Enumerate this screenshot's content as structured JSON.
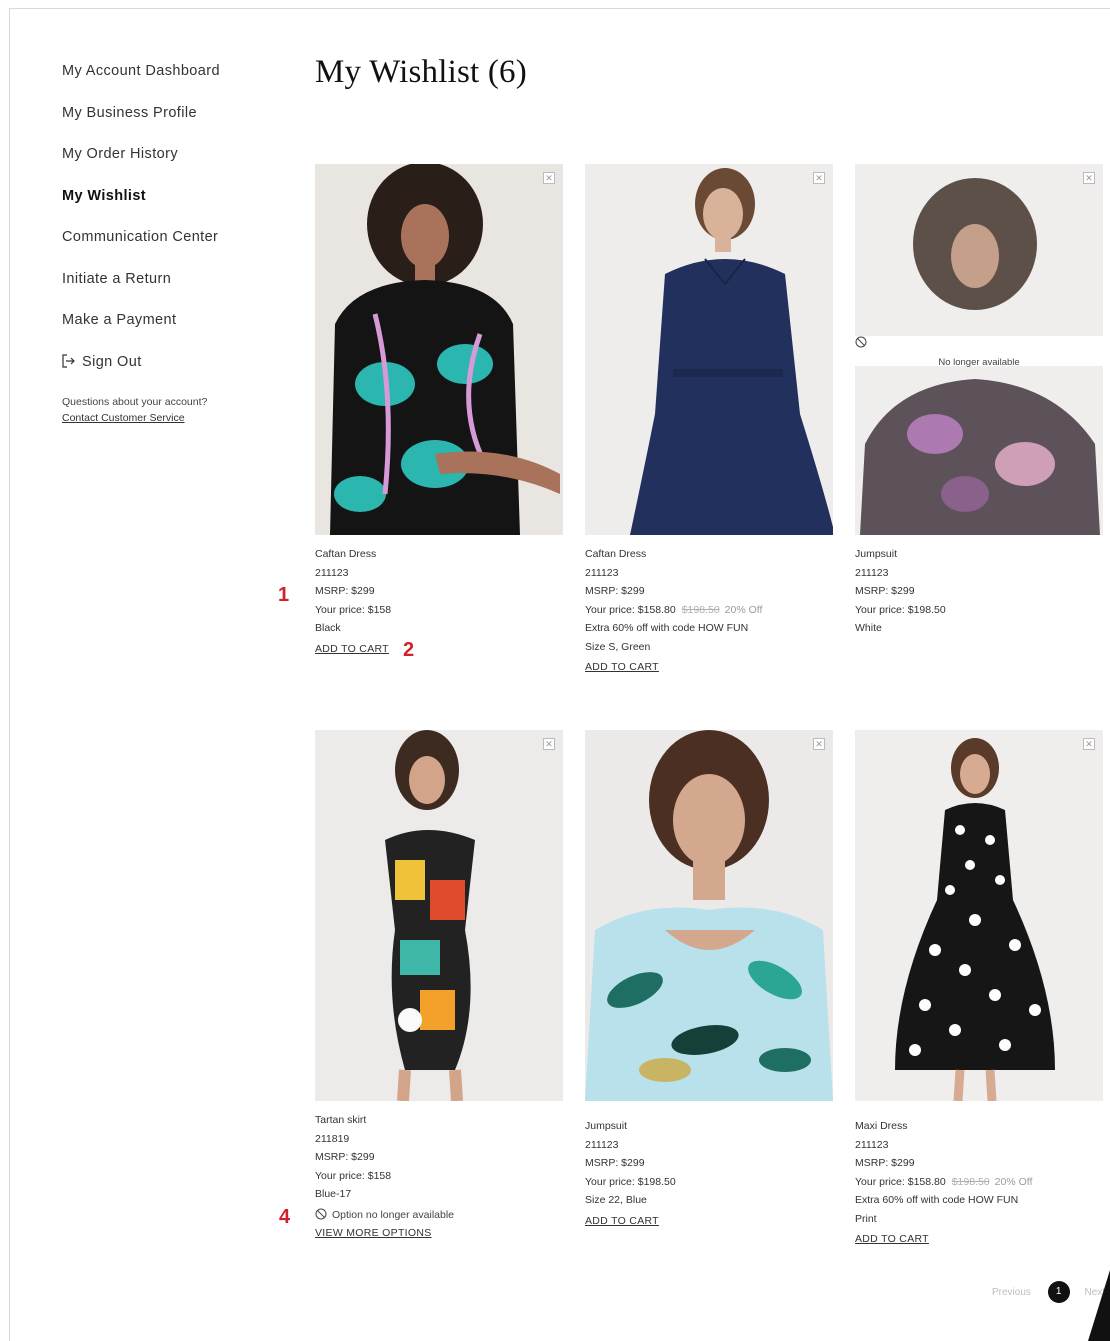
{
  "sidebar": {
    "items": [
      {
        "label": "My Account Dashboard",
        "active": false
      },
      {
        "label": "My Business Profile",
        "active": false
      },
      {
        "label": "My Order History",
        "active": false
      },
      {
        "label": "My Wishlist",
        "active": true
      },
      {
        "label": "Communication Center",
        "active": false
      },
      {
        "label": "Initiate a Return",
        "active": false
      },
      {
        "label": "Make a Payment",
        "active": false
      }
    ],
    "sign_out": "Sign Out",
    "help_text": "Questions about your account?",
    "help_link": "Contact Customer Service"
  },
  "page_title": "My Wishlist (6)",
  "products": [
    {
      "name": "Caftan Dress",
      "sku": "211123",
      "msrp": "MSRP: $299",
      "price": "Your price: $158",
      "color": "Black",
      "action": "ADD TO CART"
    },
    {
      "name": "Caftan Dress",
      "sku": "211123",
      "msrp": "MSRP: $299",
      "price": "Your price: $158.80",
      "old_price": "$198.50",
      "discount": "20% Off",
      "promo": "Extra 60% off with code HOW FUN",
      "variant": "Size S, Green",
      "action": "ADD TO CART"
    },
    {
      "name": "Jumpsuit",
      "sku": "211123",
      "msrp": "MSRP: $299",
      "price": "Your price: $198.50",
      "color": "White",
      "overlay": "No longer available"
    },
    {
      "name": "Tartan skirt",
      "sku": "211819",
      "msrp": "MSRP: $299",
      "price": "Your price: $158",
      "color": "Blue-17",
      "unavailable": "Option no longer available",
      "action": "VIEW MORE OPTIONS"
    },
    {
      "name": "Jumpsuit",
      "sku": "211123",
      "msrp": "MSRP: $299",
      "price": "Your price: $198.50",
      "variant": "Size 22, Blue",
      "action": "ADD TO CART"
    },
    {
      "name": "Maxi Dress",
      "sku": "211123",
      "msrp": "MSRP: $299",
      "price": "Your price: $158.80",
      "old_price": "$198.50",
      "discount": "20% Off",
      "promo": "Extra 60% off with code HOW FUN",
      "variant": "Print",
      "action": "ADD TO CART"
    }
  ],
  "markers": [
    "1",
    "2",
    "4"
  ],
  "pagination": {
    "previous": "Previous",
    "current": "1",
    "next": "Next"
  },
  "colors": {
    "marker": "#d0202a",
    "text": "#222222"
  },
  "icons": {
    "close": "close-icon",
    "sign_out": "sign-out-icon",
    "unavailable": "ban-icon"
  }
}
